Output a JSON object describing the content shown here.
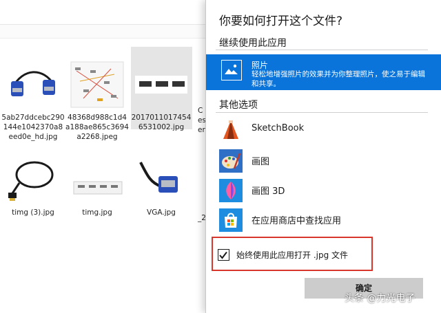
{
  "files": [
    {
      "name": "5ab27ddcebc290144e1042370a8eed0e_hd.jpg",
      "thumb": "vga-cable-blue"
    },
    {
      "name": "48368d988c1d4a188ae865c3694a2268.jpeg",
      "thumb": "diagram"
    },
    {
      "name": "20170110174546531002.jpg",
      "thumb": "connectors"
    },
    {
      "name": "timg (3).jpg",
      "thumb": "hdmi-cable-black"
    },
    {
      "name": "timg.jpg",
      "thumb": "connector-strip"
    },
    {
      "name": "VGA.jpg",
      "thumb": "vga-cable-black"
    }
  ],
  "partial_names": {
    "row1": "C\nes\ner",
    "row2": "_2"
  },
  "dialog": {
    "title": "你要如何打开这个文件?",
    "continue_section": "继续使用此应用",
    "current_app": {
      "name": "照片",
      "description": "轻松地增强照片的效果并为你整理照片，使之易于编辑和共享。",
      "icon": "photos-icon"
    },
    "other_section": "其他选项",
    "apps": [
      {
        "name": "SketchBook",
        "icon": "sketchbook-icon"
      },
      {
        "name": "画图",
        "icon": "paint-icon"
      },
      {
        "name": "画图 3D",
        "icon": "paint3d-icon"
      },
      {
        "name": "在应用商店中查找应用",
        "icon": "store-icon"
      }
    ],
    "always_use_label": "始终使用此应用打开 .jpg 文件",
    "always_use_checked": true,
    "ok_label": "确定"
  },
  "watermark": "头条 @力光电子",
  "colors": {
    "accent": "#0a74da",
    "highlight_border": "#d9362b"
  }
}
